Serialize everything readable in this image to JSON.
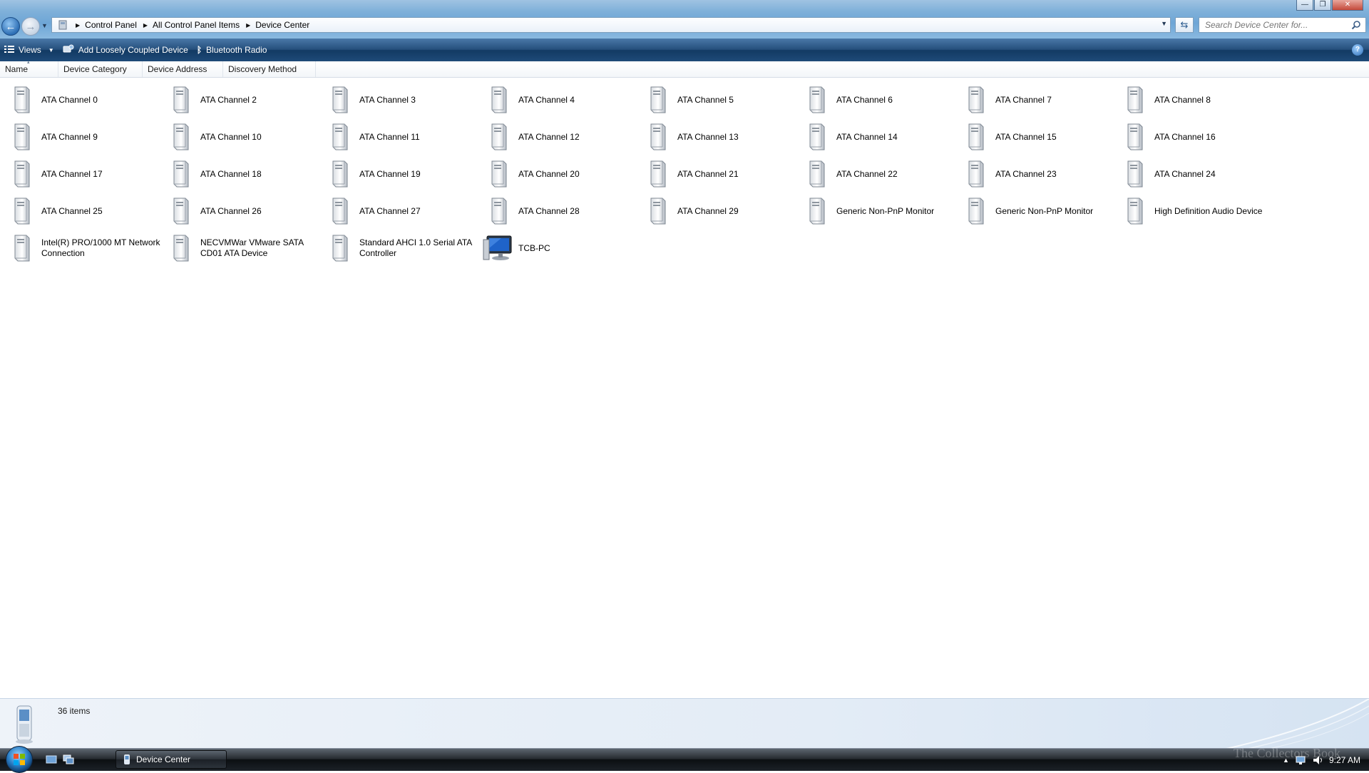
{
  "window": {
    "minimize_glyph": "—",
    "maximize_glyph": "❐",
    "close_glyph": "✕"
  },
  "address_bar": {
    "breadcrumbs": [
      "Control Panel",
      "All Control Panel Items",
      "Device Center"
    ]
  },
  "search": {
    "placeholder": "Search Device Center for..."
  },
  "command_bar": {
    "views_label": "Views",
    "add_device_label": "Add Loosely Coupled Device",
    "bluetooth_label": "Bluetooth Radio",
    "help_glyph": "?"
  },
  "columns": {
    "name": "Name",
    "category": "Device Category",
    "address": "Device Address",
    "discovery": "Discovery Method"
  },
  "items": [
    {
      "label": "ATA Channel 0",
      "icon": "drive-tower-icon"
    },
    {
      "label": "ATA Channel 2",
      "icon": "drive-tower-icon"
    },
    {
      "label": "ATA Channel 3",
      "icon": "drive-tower-icon"
    },
    {
      "label": "ATA Channel 4",
      "icon": "drive-tower-icon"
    },
    {
      "label": "ATA Channel 5",
      "icon": "drive-tower-icon"
    },
    {
      "label": "ATA Channel 6",
      "icon": "drive-tower-icon"
    },
    {
      "label": "ATA Channel 7",
      "icon": "drive-tower-icon"
    },
    {
      "label": "ATA Channel 8",
      "icon": "drive-tower-icon"
    },
    {
      "label": "ATA Channel 9",
      "icon": "drive-tower-icon"
    },
    {
      "label": "ATA Channel 10",
      "icon": "drive-tower-icon"
    },
    {
      "label": "ATA Channel 11",
      "icon": "drive-tower-icon"
    },
    {
      "label": "ATA Channel 12",
      "icon": "drive-tower-icon"
    },
    {
      "label": "ATA Channel 13",
      "icon": "drive-tower-icon"
    },
    {
      "label": "ATA Channel 14",
      "icon": "drive-tower-icon"
    },
    {
      "label": "ATA Channel 15",
      "icon": "drive-tower-icon"
    },
    {
      "label": "ATA Channel 16",
      "icon": "drive-tower-icon"
    },
    {
      "label": "ATA Channel 17",
      "icon": "drive-tower-icon"
    },
    {
      "label": "ATA Channel 18",
      "icon": "drive-tower-icon"
    },
    {
      "label": "ATA Channel 19",
      "icon": "drive-tower-icon"
    },
    {
      "label": "ATA Channel 20",
      "icon": "drive-tower-icon"
    },
    {
      "label": "ATA Channel 21",
      "icon": "drive-tower-icon"
    },
    {
      "label": "ATA Channel 22",
      "icon": "drive-tower-icon"
    },
    {
      "label": "ATA Channel 23",
      "icon": "drive-tower-icon"
    },
    {
      "label": "ATA Channel 24",
      "icon": "drive-tower-icon"
    },
    {
      "label": "ATA Channel 25",
      "icon": "drive-tower-icon"
    },
    {
      "label": "ATA Channel 26",
      "icon": "drive-tower-icon"
    },
    {
      "label": "ATA Channel 27",
      "icon": "drive-tower-icon"
    },
    {
      "label": "ATA Channel 28",
      "icon": "drive-tower-icon"
    },
    {
      "label": "ATA Channel 29",
      "icon": "drive-tower-icon"
    },
    {
      "label": "Generic Non-PnP Monitor",
      "icon": "drive-tower-icon"
    },
    {
      "label": "Generic Non-PnP Monitor",
      "icon": "drive-tower-icon"
    },
    {
      "label": "High Definition Audio Device",
      "icon": "drive-tower-icon"
    },
    {
      "label": "Intel(R) PRO/1000 MT Network Connection",
      "icon": "drive-tower-icon"
    },
    {
      "label": "NECVMWar VMware SATA CD01 ATA Device",
      "icon": "drive-tower-icon"
    },
    {
      "label": "Standard AHCI 1.0 Serial ATA Controller",
      "icon": "drive-tower-icon"
    },
    {
      "label": "TCB-PC",
      "icon": "computer-icon"
    }
  ],
  "details_pane": {
    "item_count": "36 items"
  },
  "taskbar": {
    "active_task": "Device Center",
    "clock": "9:27 AM",
    "watermark": "The Collectors Book"
  }
}
